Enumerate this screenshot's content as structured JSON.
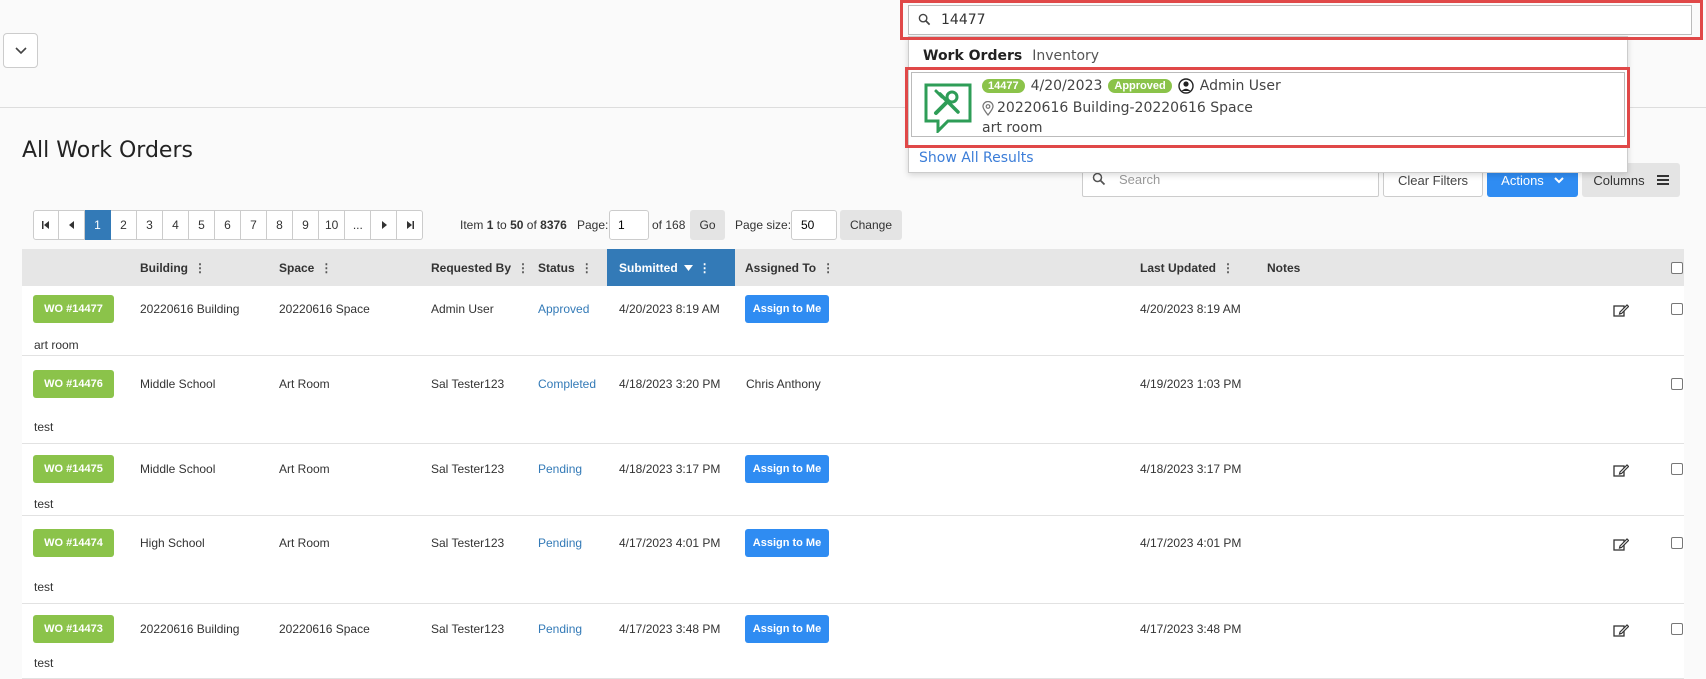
{
  "colors": {
    "accent": "#2f8cf2",
    "wo_green": "#8bc34a",
    "sorted_header": "#337ab7",
    "highlight_red": "#e04848"
  },
  "global_search": {
    "value": "14477"
  },
  "dropdown": {
    "tab_active": "Work Orders",
    "tab_other": "Inventory",
    "result": {
      "badge": "14477",
      "date": "4/20/2023",
      "status": "Approved",
      "user": "Admin User",
      "location": "20220616 Building-20220616 Space",
      "description": "art room"
    },
    "show_all": "Show All Results"
  },
  "page": {
    "title": "All Work Orders"
  },
  "toolbar": {
    "search_placeholder": "Search",
    "clear_filters": "Clear Filters",
    "actions": "Actions",
    "columns": "Columns"
  },
  "pager": {
    "pages": [
      "1",
      "2",
      "3",
      "4",
      "5",
      "6",
      "7",
      "8",
      "9",
      "10",
      "..."
    ],
    "active": "1",
    "item_label": "Item",
    "from": "1",
    "to_label": "to",
    "to": "50",
    "of_label": "of",
    "total": "8376",
    "page_label": "Page:",
    "page_value": "1",
    "page_of": "of 168",
    "go": "Go",
    "size_label": "Page size:",
    "size_value": "50",
    "change": "Change"
  },
  "table": {
    "headers": {
      "building": "Building",
      "space": "Space",
      "requested_by": "Requested By",
      "status": "Status",
      "submitted": "Submitted",
      "assigned_to": "Assigned To",
      "last_updated": "Last Updated",
      "notes": "Notes"
    },
    "assign_label": "Assign to Me",
    "rows": [
      {
        "wo": "WO #14477",
        "building": "20220616 Building",
        "space": "20220616 Space",
        "requested_by": "Admin User",
        "status": "Approved",
        "submitted": "4/20/2023 8:19 AM",
        "assigned_to": "",
        "last_updated": "4/20/2023 8:19 AM",
        "note": "art room"
      },
      {
        "wo": "WO #14476",
        "building": "Middle School",
        "space": "Art Room",
        "requested_by": "Sal Tester123",
        "status": "Completed",
        "submitted": "4/18/2023 3:20 PM",
        "assigned_to": "Chris Anthony",
        "last_updated": "4/19/2023 1:03 PM",
        "note": "test"
      },
      {
        "wo": "WO #14475",
        "building": "Middle School",
        "space": "Art Room",
        "requested_by": "Sal Tester123",
        "status": "Pending",
        "submitted": "4/18/2023 3:17 PM",
        "assigned_to": "",
        "last_updated": "4/18/2023 3:17 PM",
        "note": "test"
      },
      {
        "wo": "WO #14474",
        "building": "High School",
        "space": "Art Room",
        "requested_by": "Sal Tester123",
        "status": "Pending",
        "submitted": "4/17/2023 4:01 PM",
        "assigned_to": "",
        "last_updated": "4/17/2023 4:01 PM",
        "note": "test"
      },
      {
        "wo": "WO #14473",
        "building": "20220616 Building",
        "space": "20220616 Space",
        "requested_by": "Sal Tester123",
        "status": "Pending",
        "submitted": "4/17/2023 3:48 PM",
        "assigned_to": "",
        "last_updated": "4/17/2023 3:48 PM",
        "note": "test"
      }
    ]
  },
  "icons": [
    "chevron-down-icon",
    "search-icon",
    "caret-down-icon",
    "hamburger-icon",
    "first-page-icon",
    "prev-page-icon",
    "next-page-icon",
    "last-page-icon",
    "sort-desc-icon",
    "edit-icon",
    "work-order-icon",
    "user-circle-icon",
    "map-pin-icon"
  ]
}
